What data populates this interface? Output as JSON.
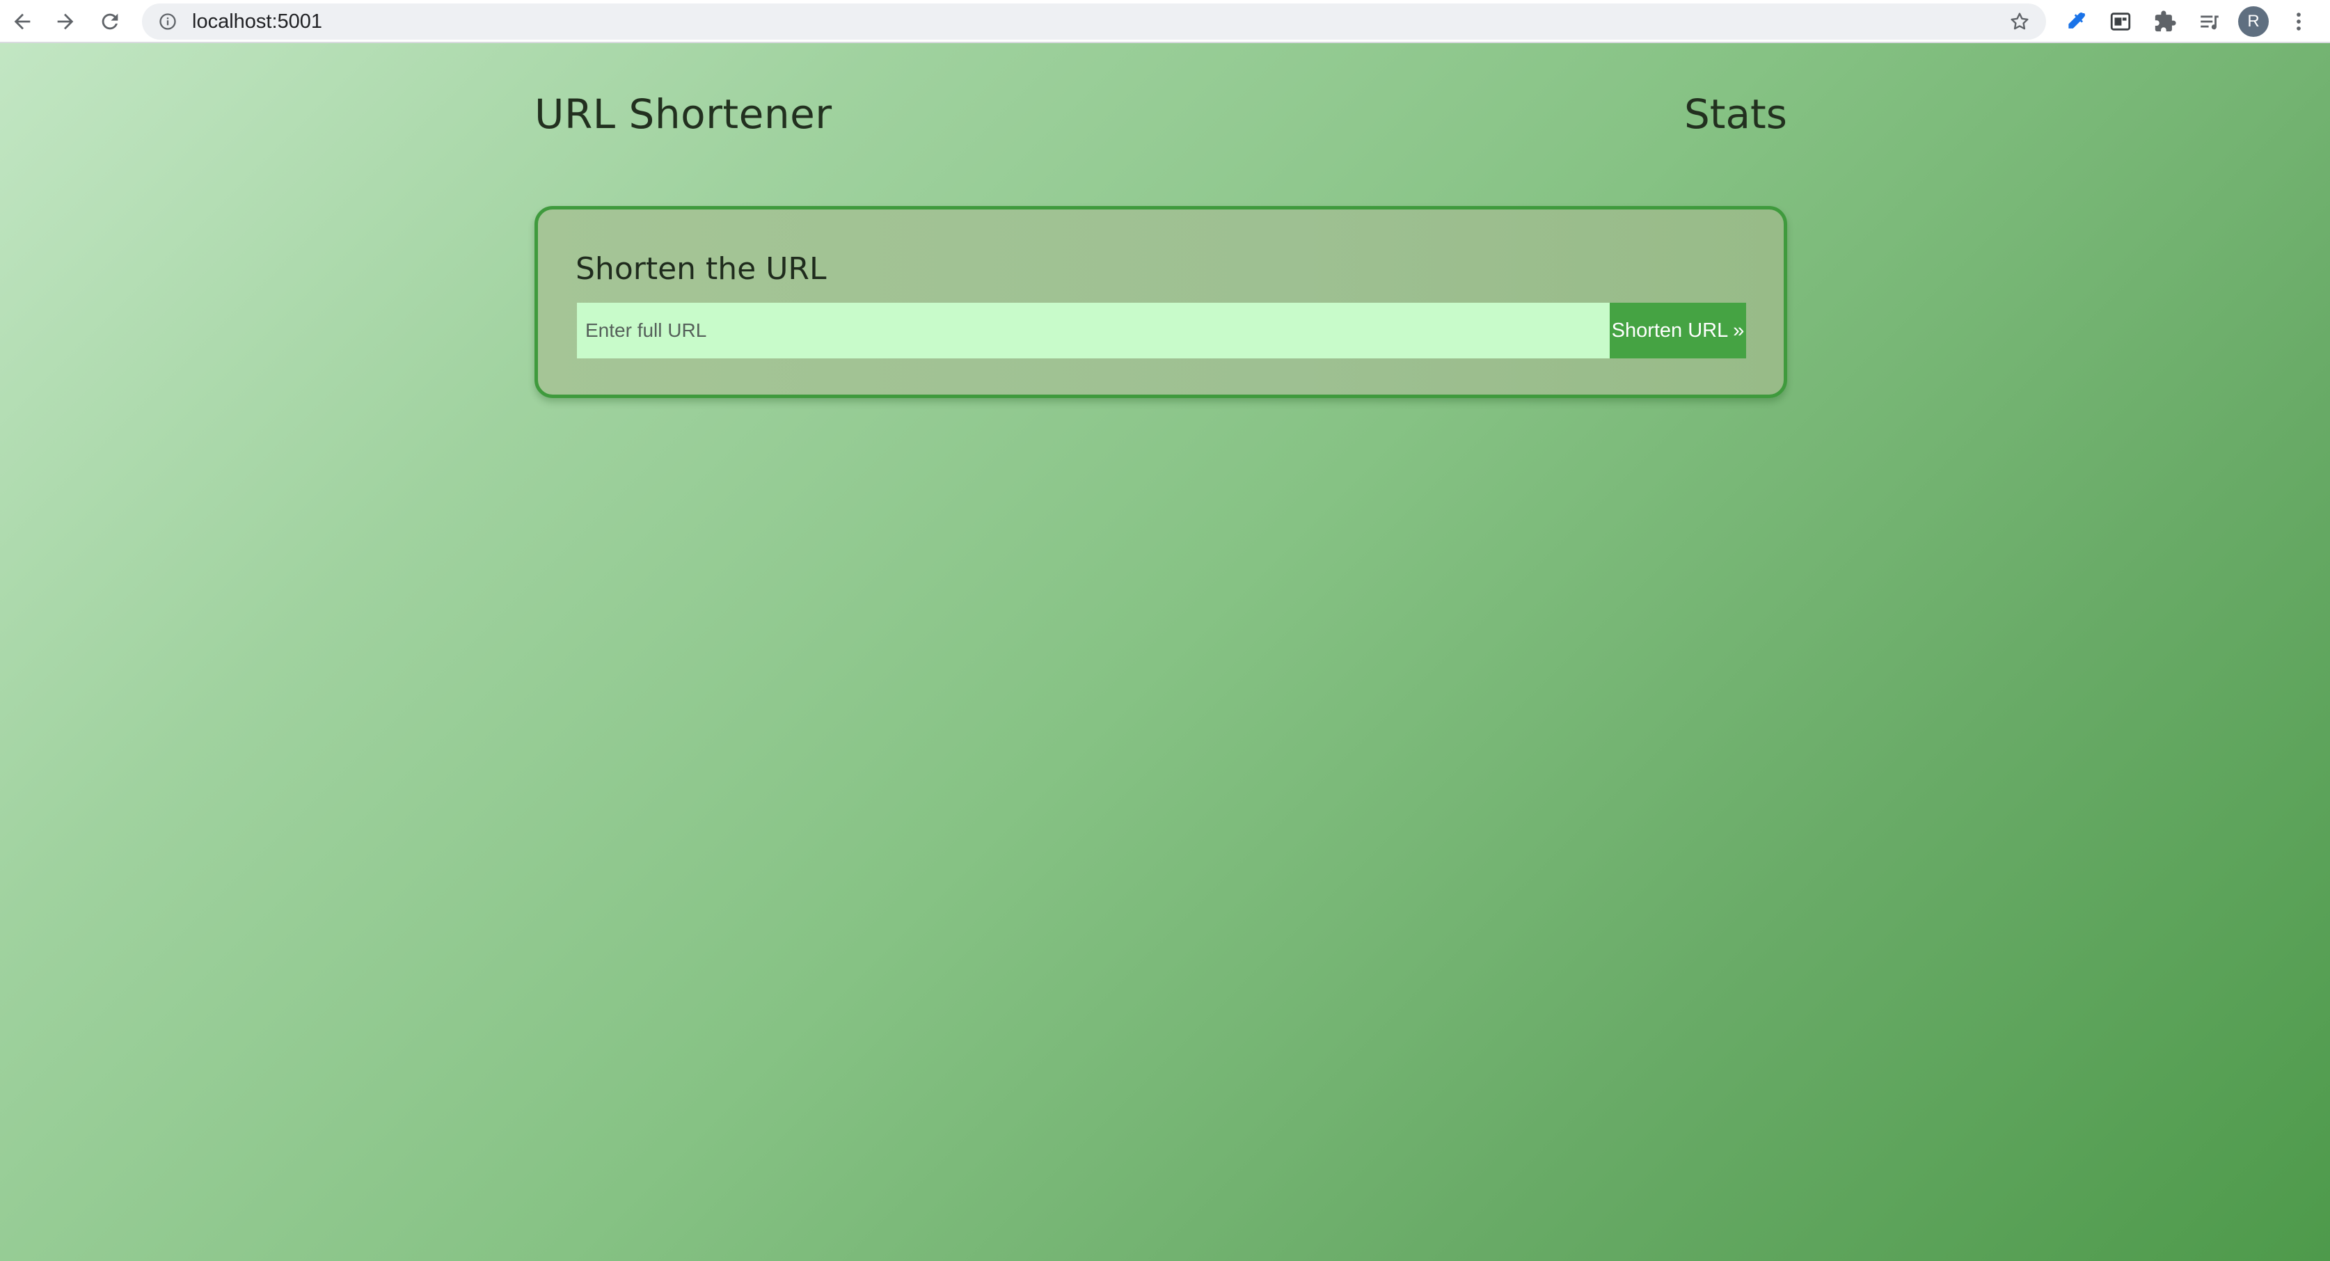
{
  "browser": {
    "url": "localhost:5001",
    "profile_initial": "R",
    "icons": {
      "back": "arrow-left-icon",
      "forward": "arrow-right-icon",
      "reload": "reload-icon",
      "site_info": "info-icon",
      "bookmark": "star-icon",
      "extensions": [
        "eyedropper-icon",
        "extension-box-icon",
        "puzzle-icon",
        "reading-list-icon"
      ],
      "menu": "kebab-menu-icon"
    }
  },
  "header": {
    "title": "URL Shortener",
    "stats_link": "Stats"
  },
  "form": {
    "title": "Shorten the URL",
    "input_placeholder": "Enter full URL",
    "input_value": "",
    "submit_label": "Shorten URL »"
  },
  "colors": {
    "card_border": "#3f9a3d",
    "button_bg": "#45a343",
    "input_bg": "#c8fbca",
    "bg_start": "#c2e6c3",
    "bg_end": "#4e9a4b"
  }
}
